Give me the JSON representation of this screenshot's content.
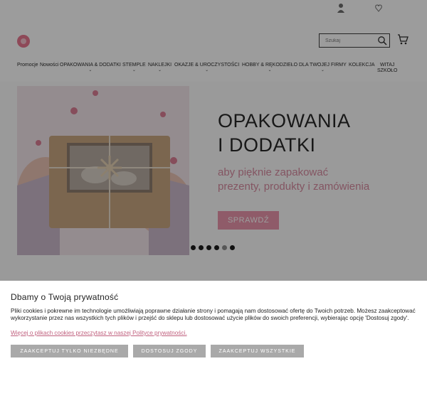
{
  "header": {
    "search": {
      "placeholder": "Szukaj"
    }
  },
  "nav": {
    "items": [
      {
        "label": "Promocje"
      },
      {
        "label": "Nowości"
      },
      {
        "label": "OPAKOWANIA & DODATKI"
      },
      {
        "label": "STEMPLE"
      },
      {
        "label": "NAKLEJKI"
      },
      {
        "label": "OKAZJE & UROCZYSTOŚCI"
      },
      {
        "label": "HOBBY & RĘKODZIEŁO"
      },
      {
        "label": "DLA TWOJEJ FIRMY"
      },
      {
        "label": "KOLEKCJA"
      },
      {
        "label": "WITAJ"
      },
      {
        "label": "SZKOŁO"
      }
    ]
  },
  "hero": {
    "title_line1": "OPAKOWANIA",
    "title_line2": "I DODATKI",
    "subtitle_line1": "aby pięknie zapakować",
    "subtitle_line2": "prezenty, produkty i zamówienia",
    "button_label": "SPRAWDŹ",
    "slides_count": 6,
    "active_slide": 6
  },
  "cookie": {
    "title": "Dbamy o Twoją prywatność",
    "text": "Pliki cookies i pokrewne im technologie umożliwiają poprawne działanie strony i pomagają nam dostosować ofertę do Twoich potrzeb. Możesz zaakceptować wykorzystanie przez nas wszystkich tych plików i przejść do sklepu lub dostosować użycie plików do swoich preferencji, wybierając opcję 'Dostosuj zgody'.",
    "link_text": "Więcej o plikach cookies przeczytasz w naszej Polityce prywatności.",
    "buttons": {
      "necessary": "ZAAKCEPTUJ TYLKO NIEZBĘDNE",
      "customize": "DOSTOSUJ ZGODY",
      "accept_all": "ZAAKCEPTUJ WSZYSTKIE"
    }
  },
  "colors": {
    "accent_pink": "#e890a8",
    "link_pink": "#c0607e",
    "button_gray": "#a9a9a9"
  }
}
